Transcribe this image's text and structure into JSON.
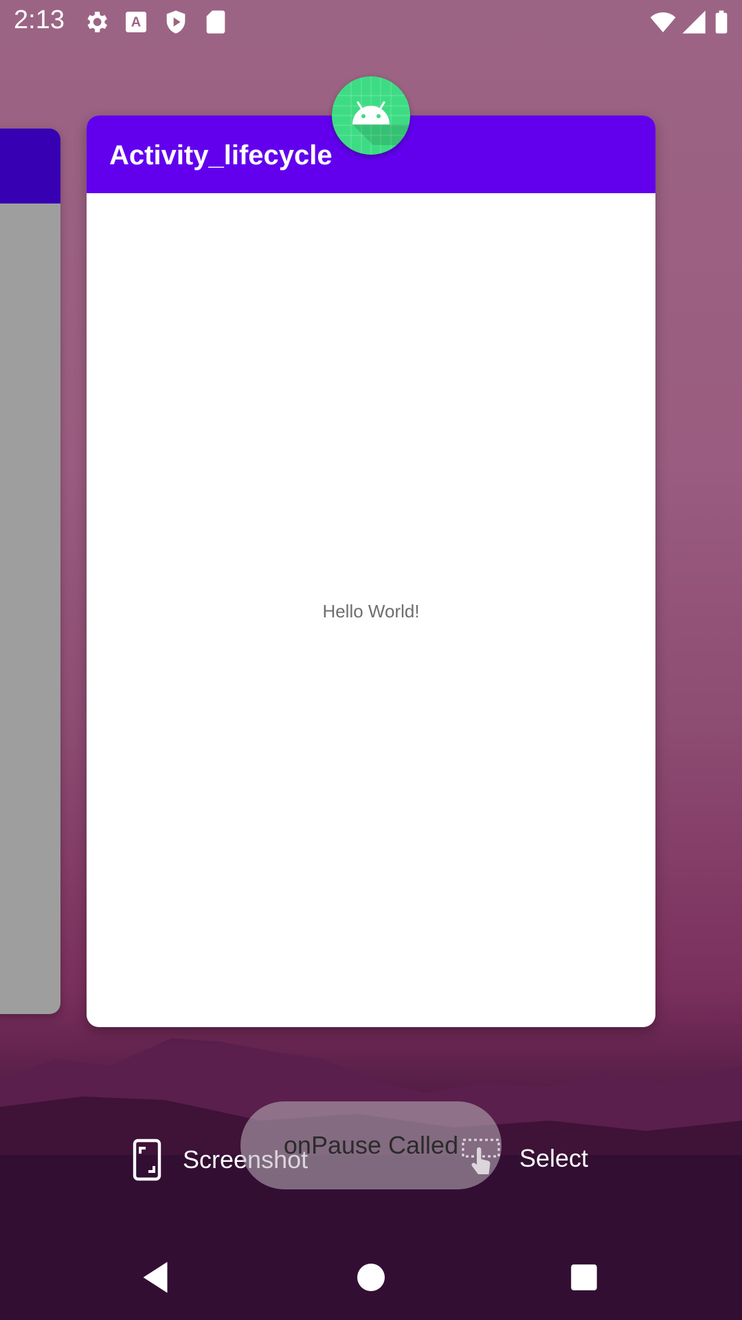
{
  "status_bar": {
    "time": "2:13",
    "left_icons": [
      "gear-icon",
      "font-a-icon",
      "shield-play-icon",
      "sd-card-icon"
    ],
    "right_icons": [
      "wifi-icon",
      "cell-signal-icon",
      "battery-icon"
    ]
  },
  "recents": {
    "main_card": {
      "app_title": "Activity_lifecycle",
      "body_text": "Hello World!",
      "app_icon": "android-icon",
      "app_bar_color": "#6200ee"
    },
    "left_card": {
      "app_bar_color": "#3700b3"
    }
  },
  "actions": {
    "screenshot_label": "Screenshot",
    "select_label": "Select"
  },
  "toast": {
    "text": "onPause Called"
  },
  "nav_bar": {
    "back": "back-icon",
    "home": "home-icon",
    "recents": "recents-icon"
  }
}
